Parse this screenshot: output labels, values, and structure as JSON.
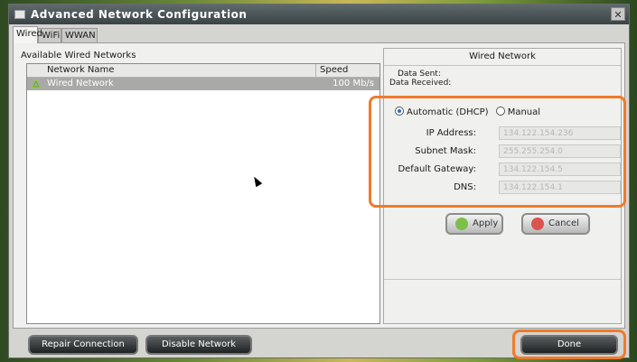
{
  "window": {
    "title": "Advanced Network Configuration",
    "close_label": "✕"
  },
  "tabs": [
    {
      "label": "Wired",
      "active": true
    },
    {
      "label": "WiFi",
      "active": false
    },
    {
      "label": "WWAN",
      "active": false
    }
  ],
  "left": {
    "section_label": "Available Wired Networks",
    "columns": [
      "Network Name",
      "Speed"
    ],
    "rows": [
      {
        "name": "Wired Network",
        "speed": "100 Mb/s",
        "icon": "network-icon"
      }
    ]
  },
  "right": {
    "header": "Wired Network",
    "data_sent_label": "Data Sent:",
    "data_received_label": "Data Received:",
    "mode_automatic": "Automatic (DHCP)",
    "mode_manual": "Manual",
    "selected_mode": "automatic",
    "fields": [
      {
        "label": "IP Address:",
        "value": "134.122.154.236"
      },
      {
        "label": "Subnet Mask:",
        "value": "255.255.254.0"
      },
      {
        "label": "Default Gateway:",
        "value": "134.122.154.5"
      },
      {
        "label": "DNS:",
        "value": "134.122.154.1"
      }
    ],
    "apply_label": "Apply",
    "cancel_label": "Cancel"
  },
  "bottom": {
    "repair_label": "Repair Connection",
    "disable_label": "Disable Network",
    "done_label": "Done"
  },
  "colors": {
    "highlight": "#f07a2a",
    "apply_icon": "#7cc04a",
    "cancel_icon": "#d9534f"
  }
}
